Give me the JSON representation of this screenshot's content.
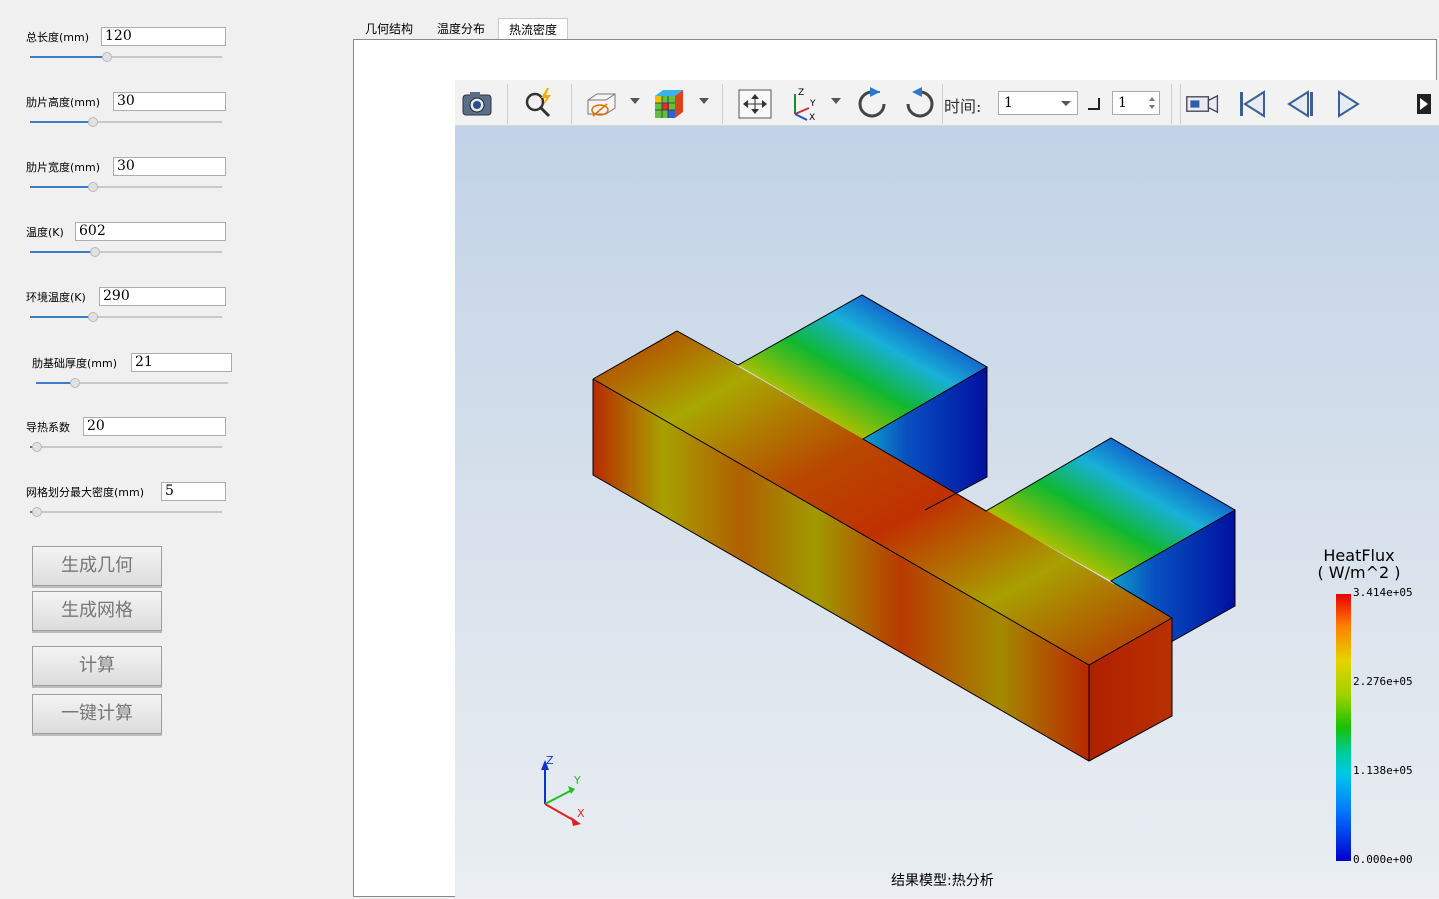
{
  "params": [
    {
      "label": "总长度(mm)",
      "value": "120"
    },
    {
      "label": "肋片高度(mm)",
      "value": "30"
    },
    {
      "label": "肋片宽度(mm)",
      "value": "30"
    },
    {
      "label": "温度(K)",
      "value": "602"
    },
    {
      "label": "环境温度(K)",
      "value": "290"
    },
    {
      "label": "肋基础厚度(mm)",
      "value": "21"
    },
    {
      "label": "导热系数",
      "value": "20"
    },
    {
      "label": "网格划分最大密度(mm)",
      "value": "5"
    }
  ],
  "buttons": {
    "generate_geometry": "生成几何",
    "generate_mesh": "生成网格",
    "compute": "计算",
    "one_click_compute": "一键计算"
  },
  "tabs": [
    "几何结构",
    "温度分布",
    "热流密度"
  ],
  "active_tab": "热流密度",
  "toolbar": {
    "time_label": "时间:",
    "time_value": "1",
    "step_value": "1",
    "icons": [
      "camera-icon",
      "magnify-lightning-icon",
      "hide-view-icon",
      "color-cube-icon",
      "fit-view-icon",
      "axes-icon",
      "rotate-cw-icon",
      "rotate-ccw-icon",
      "video-icon",
      "first-frame-icon",
      "previous-frame-icon",
      "play-icon",
      "next-icon"
    ]
  },
  "legend": {
    "title": "HeatFlux",
    "unit": "( W/m^2 )",
    "labels": [
      "3.414e+05",
      "2.276e+05",
      "1.138e+05",
      "0.000e+00"
    ]
  },
  "axis_labels": {
    "z": "Z",
    "y": "Y",
    "x": "X"
  },
  "footer": "结果模型:热分析",
  "colors": {
    "accent": "#3c7dc4",
    "hot": "#b81f00",
    "cold": "#0014b0"
  }
}
